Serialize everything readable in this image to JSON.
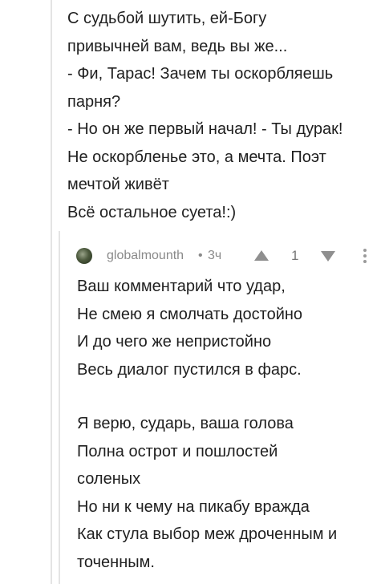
{
  "parent_comment": {
    "lines": [
      "С судьбой шутить, ей-Богу",
      "привычней вам, ведь вы же...",
      "- Фи, Тарас! Зачем ты оскорбляешь",
      "парня?",
      "- Но он же первый начал! - Ты дурак!",
      "Не оскорбленье это, а мечта. Поэт",
      "мечтой живёт",
      "Всё остальное суета!:)"
    ]
  },
  "reply": {
    "author": "globalmounth",
    "separator": "•",
    "time": "3ч",
    "rating": "1",
    "stanza1": [
      "Ваш комментарий что удар,",
      "Не смею я смолчать достойно",
      "И до чего же непристойно",
      "Весь диалог пустился в фарс."
    ],
    "stanza2": [
      "Я верю, сударь, ваша голова",
      "Полна острот и пошлостей",
      "соленых",
      "Но ни к чему на пикабу вражда",
      "Как стула выбор меж дроченным и",
      "точенным."
    ]
  },
  "icons": {
    "avatar": "avatar",
    "upvote": "upvote-icon",
    "downvote": "downvote-icon",
    "menu": "more-vertical-icon"
  }
}
